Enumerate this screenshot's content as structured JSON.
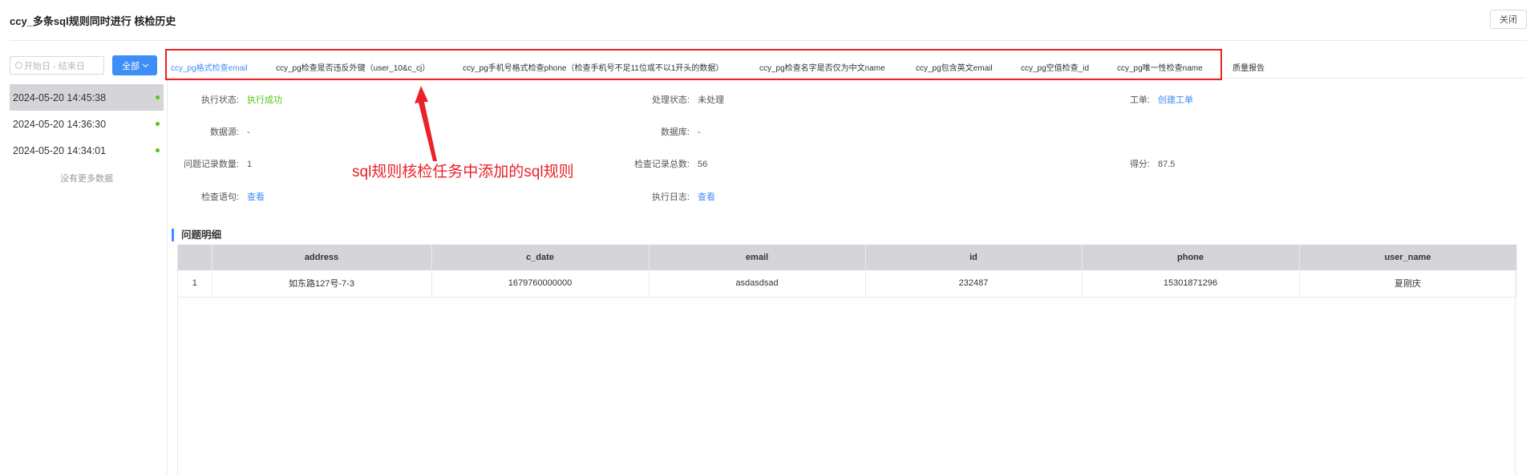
{
  "header": {
    "title": "ccy_多条sql规则同时进行 核检历史",
    "close_label": "关闭"
  },
  "filters": {
    "date_range_placeholder": "开始日 - 结束日",
    "all_button_label": "全部"
  },
  "history": {
    "items": [
      {
        "timestamp": "2024-05-20 14:45:38",
        "status_color": "#52c41a",
        "active": true
      },
      {
        "timestamp": "2024-05-20 14:36:30",
        "status_color": "#52c41a",
        "active": false
      },
      {
        "timestamp": "2024-05-20 14:34:01",
        "status_color": "#52c41a",
        "active": false
      }
    ],
    "no_more_label": "没有更多数据"
  },
  "tabs": [
    {
      "label": "ccy_pg格式检查email",
      "active": true
    },
    {
      "label": "ccy_pg检查是否违反外键（user_10&c_cj）",
      "active": false
    },
    {
      "label": "ccy_pg手机号格式检查phone（检查手机号不足11位或不以1开头的数据）",
      "active": false
    },
    {
      "label": "ccy_pg检查名字是否仅为中文name",
      "active": false
    },
    {
      "label": "ccy_pg包含英文email",
      "active": false
    },
    {
      "label": "ccy_pg空值检查_id",
      "active": false
    },
    {
      "label": "ccy_pg唯一性检查name",
      "active": false
    },
    {
      "label": "质量报告",
      "active": false
    }
  ],
  "details": {
    "exec_status_label": "执行状态:",
    "exec_status_value": "执行成功",
    "process_status_label": "处理状态:",
    "process_status_value": "未处理",
    "ticket_label": "工单:",
    "ticket_value": "创建工单",
    "datasource_label": "数据源:",
    "datasource_value": "-",
    "database_label": "数据库:",
    "database_value": "-",
    "issue_count_label": "问题记录数量:",
    "issue_count_value": "1",
    "total_count_label": "检查记录总数:",
    "total_count_value": "56",
    "score_label": "得分:",
    "score_value": "87.5",
    "sql_label": "检查语句:",
    "sql_value": "查看",
    "log_label": "执行日志:",
    "log_value": "查看"
  },
  "annotation": {
    "text": "sql规则核检任务中添加的sql规则",
    "color": "#ea2127"
  },
  "issues": {
    "title": "问题明细",
    "columns": [
      "",
      "address",
      "c_date",
      "email",
      "id",
      "phone",
      "user_name"
    ],
    "rows": [
      [
        "1",
        "如东路127号-7-3",
        "1679760000000",
        "asdasdsad",
        "232487",
        "15301871296",
        "夏刚庆"
      ]
    ]
  },
  "colors": {
    "accent": "#3e8ef7",
    "success": "#52c41a",
    "header_bg": "#d3d5d9"
  }
}
